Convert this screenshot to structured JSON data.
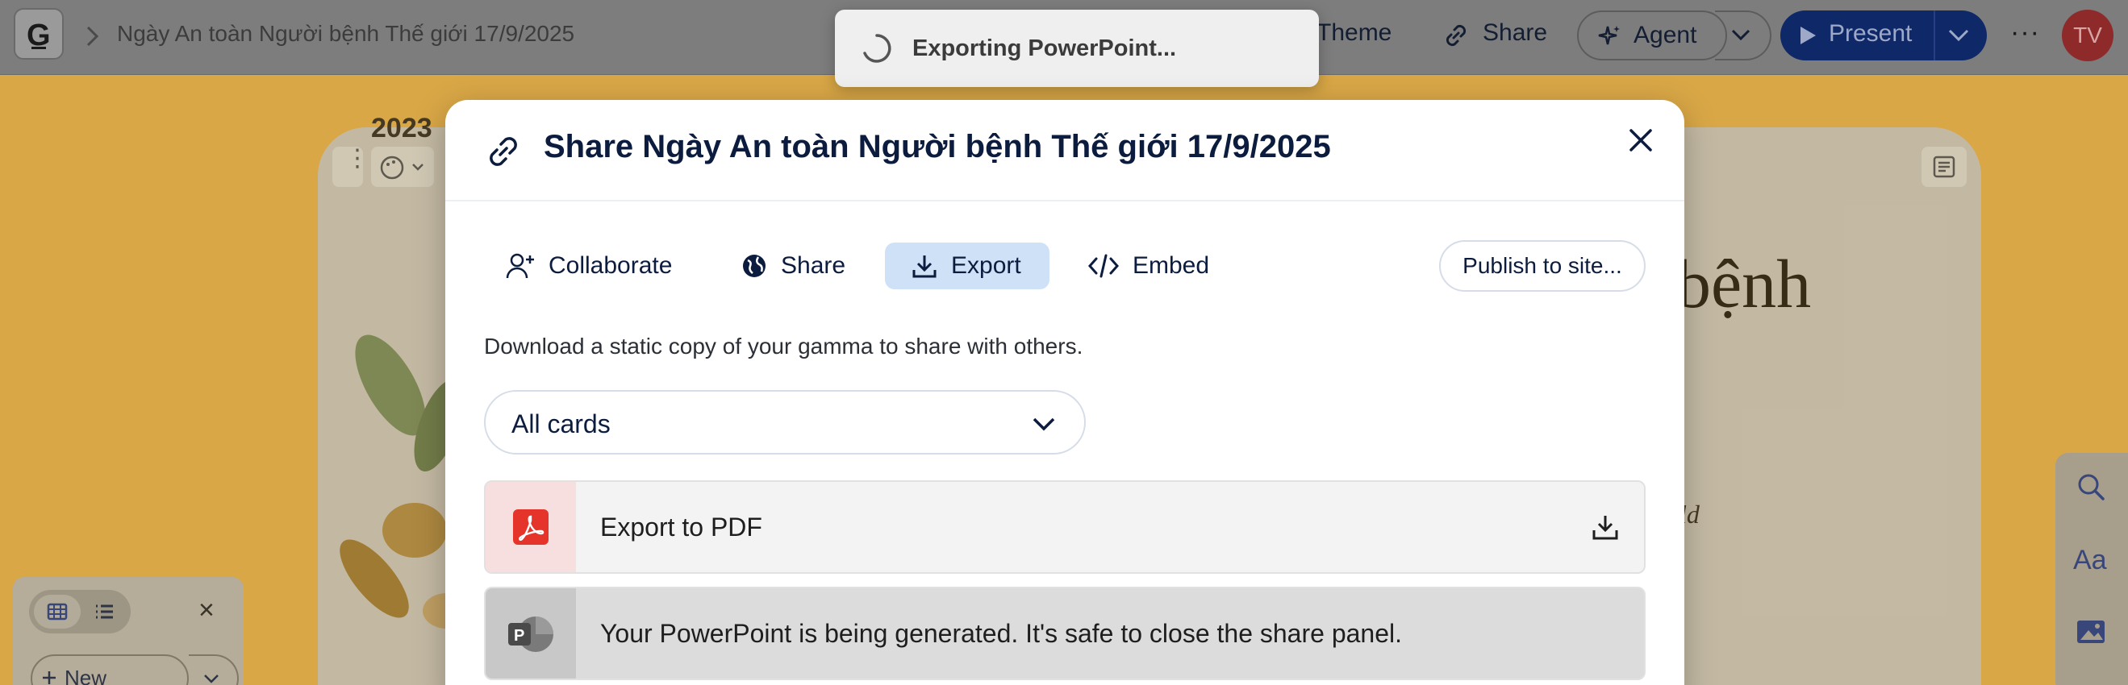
{
  "topbar": {
    "doc_title": "Ngày An toàn Người bệnh Thế giới 17/9/2025",
    "theme_label": "Theme",
    "share_label": "Share",
    "agent_label": "Agent",
    "present_label": "Present",
    "more_label": "···",
    "avatar_initials": "TV",
    "icons": [
      "gamma-logo-icon",
      "chevron-right-icon",
      "link-icon",
      "sparkle-icon",
      "chevron-down-icon",
      "play-icon",
      "more-icon"
    ]
  },
  "slide": {
    "year_fragment": "2023",
    "heading_fragment": "bệnh",
    "italic_fragment": "ld"
  },
  "left_panel": {
    "new_label": "New",
    "close_label": "×"
  },
  "toast": {
    "text": "Exporting PowerPoint..."
  },
  "modal": {
    "title": "Share Ngày An toàn Người bệnh Thế giới 17/9/2025",
    "tabs": [
      {
        "label": "Collaborate",
        "icon": "user-plus-icon",
        "active": false
      },
      {
        "label": "Share",
        "icon": "globe-icon",
        "active": false
      },
      {
        "label": "Export",
        "icon": "download-icon",
        "active": true
      },
      {
        "label": "Embed",
        "icon": "code-icon",
        "active": false
      }
    ],
    "publish_label": "Publish to site...",
    "description": "Download a static copy of your gamma to share with others.",
    "select_value": "All cards",
    "rows": [
      {
        "label": "Export to PDF",
        "icon": "pdf-icon"
      },
      {
        "label": "Your PowerPoint is being generated. It's safe to close the share panel.",
        "icon": "powerpoint-icon"
      }
    ]
  },
  "colors": {
    "accent": "#0e2868",
    "active_tab": "#cfe1f7",
    "pdf_red": "#e5352b",
    "background": "#e2ad4a"
  }
}
